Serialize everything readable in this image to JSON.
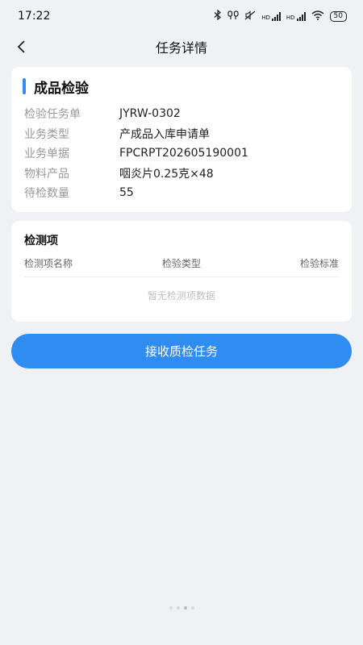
{
  "status_bar": {
    "time": "17:22",
    "network_hd1": "HD",
    "network_hd2": "HD",
    "battery": "50"
  },
  "nav": {
    "title": "任务详情",
    "back_icon": "chevron-left-icon"
  },
  "inspection": {
    "title": "成品检验",
    "accent_color": "#2f8cf0",
    "rows": [
      {
        "label": "检验任务单",
        "value": "JYRW-0302"
      },
      {
        "label": "业务类型",
        "value": "产成品入库申请单"
      },
      {
        "label": "业务单据",
        "value": "FPCRPT202605190001"
      },
      {
        "label": "物料产品",
        "value": "咽炎片0.25克×48"
      },
      {
        "label": "待检数量",
        "value": "55"
      }
    ]
  },
  "checks": {
    "title": "检测项",
    "columns": [
      "检测项名称",
      "检验类型",
      "检验标准"
    ],
    "empty_text": "暂无检测项数据"
  },
  "actions": {
    "accept_label": "接收质检任务",
    "button_color": "#2f8cf0"
  }
}
